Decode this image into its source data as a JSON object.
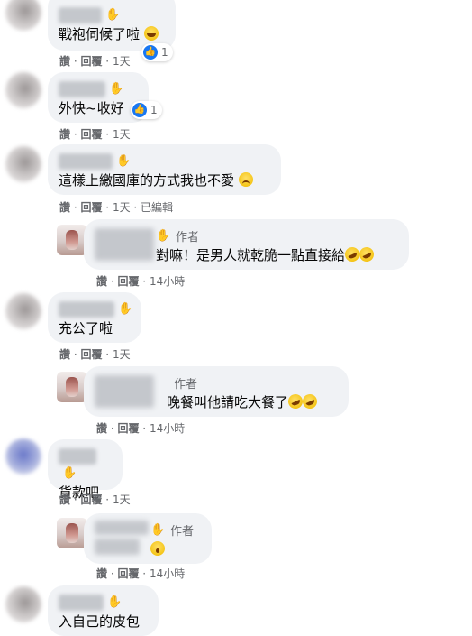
{
  "comments": [
    {
      "text": "戰袍伺候了啦",
      "reaction_count": "1",
      "actions": {
        "like": "讚",
        "reply": "回覆",
        "time": "1天"
      }
    },
    {
      "text": "外快~收好",
      "reaction_count": "1",
      "actions": {
        "like": "讚",
        "reply": "回覆",
        "time": "1天"
      }
    },
    {
      "text": "這樣上繳國庫的方式我也不愛",
      "actions": {
        "like": "讚",
        "reply": "回覆",
        "time": "1天",
        "edited": "已編輯"
      }
    },
    {
      "text": "對嘛！是男人就乾脆一點直接給",
      "author_label": "作者",
      "actions": {
        "like": "讚",
        "reply": "回覆",
        "time": "14小時"
      }
    },
    {
      "text": "充公了啦",
      "actions": {
        "like": "讚",
        "reply": "回覆",
        "time": "1天"
      }
    },
    {
      "text": "晚餐叫他請吃大餐了",
      "author_label": "作者",
      "actions": {
        "like": "讚",
        "reply": "回覆",
        "time": "14小時"
      }
    },
    {
      "text": "貨款吧",
      "actions": {
        "like": "讚",
        "reply": "回覆",
        "time": "1天"
      }
    },
    {
      "text": "",
      "author_label": "作者",
      "actions": {
        "like": "讚",
        "reply": "回覆",
        "time": "14小時"
      }
    },
    {
      "text": "入自己的皮包"
    }
  ],
  "separator": " · ",
  "colors": {
    "bubble": "#f0f2f5",
    "meta": "#65676b",
    "like_blue": "#1877f2"
  }
}
